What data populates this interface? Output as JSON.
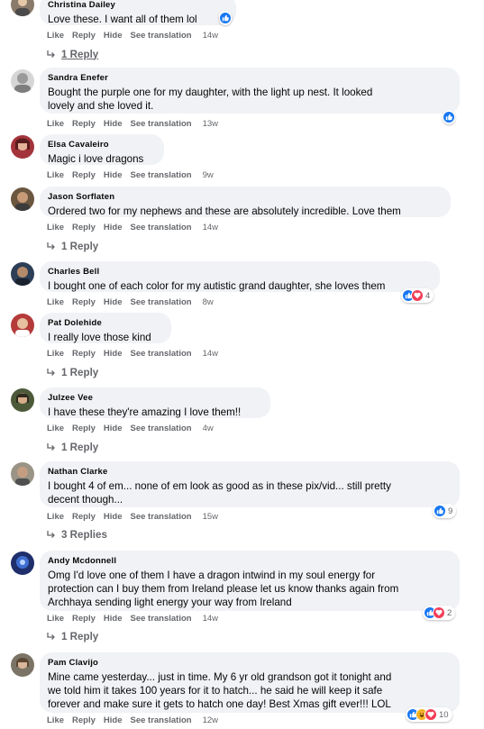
{
  "actions": {
    "like": "Like",
    "reply": "Reply",
    "hide": "Hide",
    "translate": "See translation"
  },
  "comments": [
    {
      "name": "Christina Dailey",
      "lines": [
        "Love these. I want all of them lol"
      ],
      "time": "14w",
      "replies": "1 Reply",
      "reaction_count": ""
    },
    {
      "name": "Sandra Enefer",
      "lines": [
        "Bought the purple one for my daughter, with the light up nest. It looked",
        "lovely and she loved it."
      ],
      "time": "13w",
      "replies": "",
      "reaction_count": ""
    },
    {
      "name": "Elsa Cavaleiro",
      "lines": [
        "Magic i love dragons"
      ],
      "time": "9w",
      "replies": "",
      "reaction_count": ""
    },
    {
      "name": "Jason Sorflaten",
      "lines": [
        "Ordered two for my nephews and these are absolutely incredible. Love them"
      ],
      "time": "14w",
      "replies": "1 Reply",
      "reaction_count": ""
    },
    {
      "name": "Charles Bell",
      "lines": [
        "I bought one of each color for my autistic grand daughter, she loves them"
      ],
      "time": "8w",
      "replies": "",
      "reaction_count": "4"
    },
    {
      "name": "Pat Dolehide",
      "lines": [
        "I really love those kind"
      ],
      "time": "14w",
      "replies": "1 Reply",
      "reaction_count": ""
    },
    {
      "name": "Julzee Vee",
      "lines": [
        "I have these they're amazing I love them!!"
      ],
      "time": "4w",
      "replies": "1 Reply",
      "reaction_count": ""
    },
    {
      "name": "Nathan Clarke",
      "lines": [
        "I bought 4 of em... none of em look as good as in these pix/vid... still pretty",
        "decent though..."
      ],
      "time": "15w",
      "replies": "3 Replies",
      "reaction_count": "9"
    },
    {
      "name": "Andy Mcdonnell",
      "lines": [
        "Omg I'd love one of them I have a dragon intwind in my soul energy for",
        "protection can I buy them from Ireland please let us know thanks again from",
        "Archhaya sending light energy your way from Ireland"
      ],
      "time": "14w",
      "replies": "1 Reply",
      "reaction_count": "2"
    },
    {
      "name": "Pam Clavijo",
      "lines": [
        "Mine came yesterday... just in time. My 6 yr old grandson got it tonight and",
        "we told him it takes 100 years for it to hatch... he said he will keep it safe",
        "forever and make sure it gets to hatch one day! Best Xmas gift ever!!! LOL"
      ],
      "time": "12w",
      "replies": "",
      "reaction_count": "10"
    }
  ],
  "colors": {
    "bubble": "#f0f2f5",
    "meta": "#65676b",
    "like": "#1877f2",
    "love": "#f33e58",
    "haha": "#f7b125"
  }
}
